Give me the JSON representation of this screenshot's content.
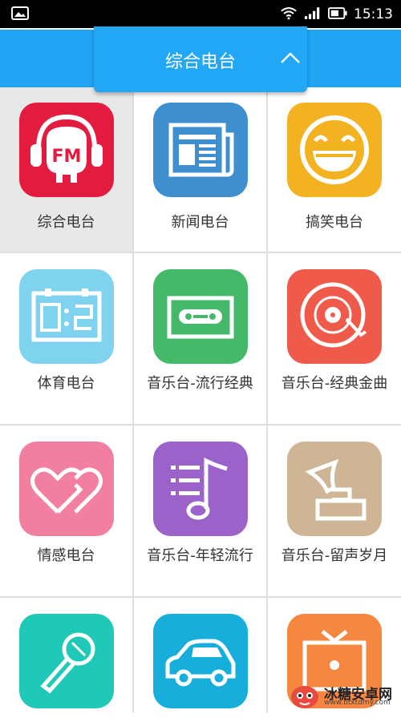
{
  "status_bar": {
    "time": "15:13",
    "icons": [
      "image-notification-icon",
      "wifi-icon",
      "signal-icon",
      "battery-icon"
    ]
  },
  "header": {
    "title": "综合电台",
    "toggle_icon": "chevron-up-icon",
    "accent_color": "#20a4f3"
  },
  "categories": [
    {
      "label": "综合电台",
      "icon": "fm-headphones-icon",
      "color": "#e31b3e",
      "selected": true
    },
    {
      "label": "新闻电台",
      "icon": "newspaper-icon",
      "color": "#3d8fd0",
      "selected": false
    },
    {
      "label": "搞笑电台",
      "icon": "laughing-face-icon",
      "color": "#f3b21f",
      "selected": false
    },
    {
      "label": "体育电台",
      "icon": "scoreboard-icon",
      "color": "#7fd3ef",
      "selected": false
    },
    {
      "label": "音乐台-流行经典",
      "icon": "cassette-icon",
      "color": "#44b96a",
      "selected": false
    },
    {
      "label": "音乐台-经典金曲",
      "icon": "vinyl-record-icon",
      "color": "#ef5a4b",
      "selected": false
    },
    {
      "label": "情感电台",
      "icon": "hearts-icon",
      "color": "#f27fa0",
      "selected": false
    },
    {
      "label": "音乐台-年轻流行",
      "icon": "music-note-icon",
      "color": "#9b62c9",
      "selected": false
    },
    {
      "label": "音乐台-留声岁月",
      "icon": "gramophone-icon",
      "color": "#cdb596",
      "selected": false
    },
    {
      "label": "",
      "icon": "microphone-icon",
      "color": "#20c9b7",
      "selected": false
    },
    {
      "label": "",
      "icon": "car-icon",
      "color": "#18aedb",
      "selected": false
    },
    {
      "label": "",
      "icon": "tv-icon",
      "color": "#f58740",
      "selected": false
    }
  ],
  "watermark": {
    "name": "冰糖安卓网",
    "url": "www.btxtdmy.com"
  }
}
